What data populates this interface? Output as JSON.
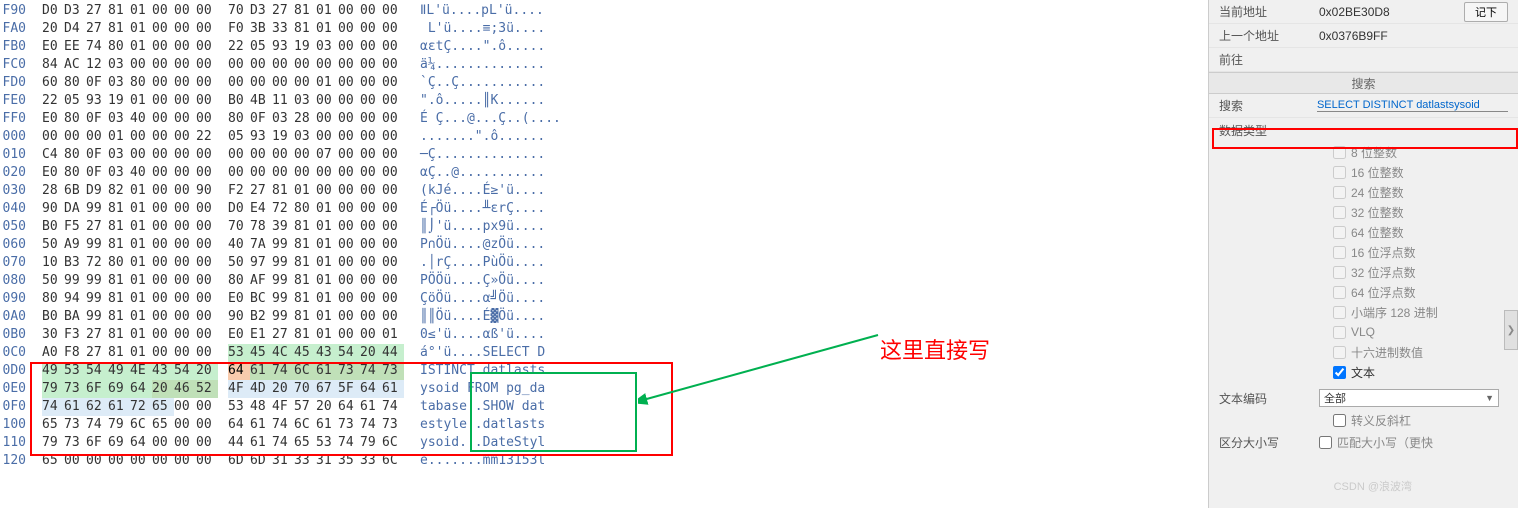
{
  "hex": {
    "rows": [
      {
        "off": "F90",
        "b": [
          "D0",
          "D3",
          "27",
          "81",
          "01",
          "00",
          "00",
          "00",
          "70",
          "D3",
          "27",
          "81",
          "01",
          "00",
          "00",
          "00"
        ],
        "a": "ⅡL'ü....pL'ü....",
        "hl": []
      },
      {
        "off": "FA0",
        "b": [
          "20",
          "D4",
          "27",
          "81",
          "01",
          "00",
          "00",
          "00",
          "F0",
          "3B",
          "33",
          "81",
          "01",
          "00",
          "00",
          "00"
        ],
        "a": " L'ü....≡;3ü....",
        "hl": []
      },
      {
        "off": "FB0",
        "b": [
          "E0",
          "EE",
          "74",
          "80",
          "01",
          "00",
          "00",
          "00",
          "22",
          "05",
          "93",
          "19",
          "03",
          "00",
          "00",
          "00"
        ],
        "a": "αεtÇ....\".ô.....",
        "hl": []
      },
      {
        "off": "FC0",
        "b": [
          "84",
          "AC",
          "12",
          "03",
          "00",
          "00",
          "00",
          "00",
          "00",
          "00",
          "00",
          "00",
          "00",
          "00",
          "00",
          "00"
        ],
        "a": "ä¼..............",
        "hl": []
      },
      {
        "off": "FD0",
        "b": [
          "60",
          "80",
          "0F",
          "03",
          "80",
          "00",
          "00",
          "00",
          "00",
          "00",
          "00",
          "00",
          "01",
          "00",
          "00",
          "00"
        ],
        "a": "`Ç..Ç...........",
        "hl": []
      },
      {
        "off": "FE0",
        "b": [
          "22",
          "05",
          "93",
          "19",
          "01",
          "00",
          "00",
          "00",
          "B0",
          "4B",
          "11",
          "03",
          "00",
          "00",
          "00",
          "00"
        ],
        "a": "\".ô.....║K......",
        "hl": []
      },
      {
        "off": "FF0",
        "b": [
          "E0",
          "80",
          "0F",
          "03",
          "40",
          "00",
          "00",
          "00",
          "80",
          "0F",
          "03",
          "28",
          "00",
          "00",
          "00",
          "00"
        ],
        "a": "É Ç...@...Ç..(....",
        "hl": []
      },
      {
        "off": "000",
        "b": [
          "00",
          "00",
          "00",
          "01",
          "00",
          "00",
          "00",
          "22",
          "05",
          "93",
          "19",
          "03",
          "00",
          "00",
          "00",
          "00"
        ],
        "a": ".......\".ô......",
        "hl": []
      },
      {
        "off": "010",
        "b": [
          "C4",
          "80",
          "0F",
          "03",
          "00",
          "00",
          "00",
          "00",
          "00",
          "00",
          "00",
          "00",
          "07",
          "00",
          "00",
          "00"
        ],
        "a": "─Ç..............",
        "hl": []
      },
      {
        "off": "020",
        "b": [
          "E0",
          "80",
          "0F",
          "03",
          "40",
          "00",
          "00",
          "00",
          "00",
          "00",
          "00",
          "00",
          "00",
          "00",
          "00",
          "00"
        ],
        "a": "αÇ..@...........",
        "hl": []
      },
      {
        "off": "030",
        "b": [
          "28",
          "6B",
          "D9",
          "82",
          "01",
          "00",
          "00",
          "90",
          "F2",
          "27",
          "81",
          "01",
          "00",
          "00",
          "00",
          "00"
        ],
        "a": "(kJé....É≥'ü....",
        "hl": []
      },
      {
        "off": "040",
        "b": [
          "90",
          "DA",
          "99",
          "81",
          "01",
          "00",
          "00",
          "00",
          "D0",
          "E4",
          "72",
          "80",
          "01",
          "00",
          "00",
          "00"
        ],
        "a": "É┌Öü....╨εrÇ....",
        "hl": []
      },
      {
        "off": "050",
        "b": [
          "B0",
          "F5",
          "27",
          "81",
          "01",
          "00",
          "00",
          "00",
          "70",
          "78",
          "39",
          "81",
          "01",
          "00",
          "00",
          "00"
        ],
        "a": "║⌡'ü....px9ü....",
        "hl": []
      },
      {
        "off": "060",
        "b": [
          "50",
          "A9",
          "99",
          "81",
          "01",
          "00",
          "00",
          "00",
          "40",
          "7A",
          "99",
          "81",
          "01",
          "00",
          "00",
          "00"
        ],
        "a": "P∩Öü....@zÖü....",
        "hl": []
      },
      {
        "off": "070",
        "b": [
          "10",
          "B3",
          "72",
          "80",
          "01",
          "00",
          "00",
          "00",
          "50",
          "97",
          "99",
          "81",
          "01",
          "00",
          "00",
          "00"
        ],
        "a": ".│rÇ....PùÖü....",
        "hl": []
      },
      {
        "off": "080",
        "b": [
          "50",
          "99",
          "99",
          "81",
          "01",
          "00",
          "00",
          "00",
          "80",
          "AF",
          "99",
          "81",
          "01",
          "00",
          "00",
          "00"
        ],
        "a": "PÖÖü....Ç»Öü....",
        "hl": []
      },
      {
        "off": "090",
        "b": [
          "80",
          "94",
          "99",
          "81",
          "01",
          "00",
          "00",
          "00",
          "E0",
          "BC",
          "99",
          "81",
          "01",
          "00",
          "00",
          "00"
        ],
        "a": "ÇöÖü....α╝Öü....",
        "hl": []
      },
      {
        "off": "0A0",
        "b": [
          "B0",
          "BA",
          "99",
          "81",
          "01",
          "00",
          "00",
          "00",
          "90",
          "B2",
          "99",
          "81",
          "01",
          "00",
          "00",
          "00"
        ],
        "a": "║║Öü....É▓Öü....",
        "hl": []
      },
      {
        "off": "0B0",
        "b": [
          "30",
          "F3",
          "27",
          "81",
          "01",
          "00",
          "00",
          "00",
          "E0",
          "E1",
          "27",
          "81",
          "01",
          "00",
          "00",
          "01"
        ],
        "a": "0≤'ü....αß'ü....",
        "hl": []
      },
      {
        "off": "0C0",
        "b": [
          "A0",
          "F8",
          "27",
          "81",
          "01",
          "00",
          "00",
          "00",
          "53",
          "45",
          "4C",
          "45",
          "43",
          "54",
          "20",
          "44"
        ],
        "a": "á°'ü....SELECT D",
        "hl": [
          [
            8,
            15,
            "g"
          ]
        ]
      },
      {
        "off": "0D0",
        "b": [
          "49",
          "53",
          "54",
          "49",
          "4E",
          "43",
          "54",
          "20",
          "64",
          "61",
          "74",
          "6C",
          "61",
          "73",
          "74",
          "73"
        ],
        "a": "ISTINCT datlasts",
        "hl": [
          [
            0,
            7,
            "g"
          ],
          [
            8,
            8,
            "o"
          ],
          [
            9,
            15,
            "d"
          ]
        ]
      },
      {
        "off": "0E0",
        "b": [
          "79",
          "73",
          "6F",
          "69",
          "64",
          "20",
          "46",
          "52",
          "4F",
          "4D",
          "20",
          "70",
          "67",
          "5F",
          "64",
          "61"
        ],
        "a": "ysoid FROM pg_da",
        "hl": [
          [
            0,
            4,
            "g"
          ],
          [
            5,
            7,
            "d"
          ],
          [
            8,
            15,
            "c"
          ]
        ]
      },
      {
        "off": "0F0",
        "b": [
          "74",
          "61",
          "62",
          "61",
          "72",
          "65",
          "00",
          "00",
          "53",
          "48",
          "4F",
          "57",
          "20",
          "64",
          "61",
          "74"
        ],
        "a": "tabase..SHOW dat",
        "hl": [
          [
            0,
            5,
            "c"
          ]
        ]
      },
      {
        "off": "100",
        "b": [
          "65",
          "73",
          "74",
          "79",
          "6C",
          "65",
          "00",
          "00",
          "64",
          "61",
          "74",
          "6C",
          "61",
          "73",
          "74",
          "73"
        ],
        "a": "estyle..datlasts",
        "hl": []
      },
      {
        "off": "110",
        "b": [
          "79",
          "73",
          "6F",
          "69",
          "64",
          "00",
          "00",
          "00",
          "44",
          "61",
          "74",
          "65",
          "53",
          "74",
          "79",
          "6C"
        ],
        "a": "ysoid...DateStyl",
        "hl": []
      },
      {
        "off": "120",
        "b": [
          "65",
          "00",
          "00",
          "00",
          "00",
          "00",
          "00",
          "00",
          "6D",
          "6D",
          "31",
          "33",
          "31",
          "35",
          "33",
          "6C"
        ],
        "a": "e.......mm13153l",
        "hl": []
      }
    ]
  },
  "annotation": "这里直接写",
  "sidebar": {
    "cur_addr_lbl": "当前地址",
    "cur_addr": "0x02BE30D8",
    "note_btn": "记下",
    "prev_addr_lbl": "上一个地址",
    "prev_addr": "0x0376B9FF",
    "goto_lbl": "前往",
    "search_hdr": "搜索",
    "search_lbl": "搜索",
    "search_val": "SELECT DISTINCT datlastsysoid",
    "dtype_lbl": "数据类型",
    "types": [
      "8 位整数",
      "16 位整数",
      "24 位整数",
      "32 位整数",
      "64 位整数",
      "16 位浮点数",
      "32 位浮点数",
      "64 位浮点数",
      "小端序 128 进制",
      "VLQ",
      "十六进制数值",
      "文本"
    ],
    "text_checked": 11,
    "enc_lbl": "文本编码",
    "enc_val": "全部",
    "esc_lbl": "转义反斜杠",
    "case_lbl": "区分大小写",
    "case_chk": "匹配大小写（更快"
  },
  "watermark": "CSDN @浪波湾"
}
